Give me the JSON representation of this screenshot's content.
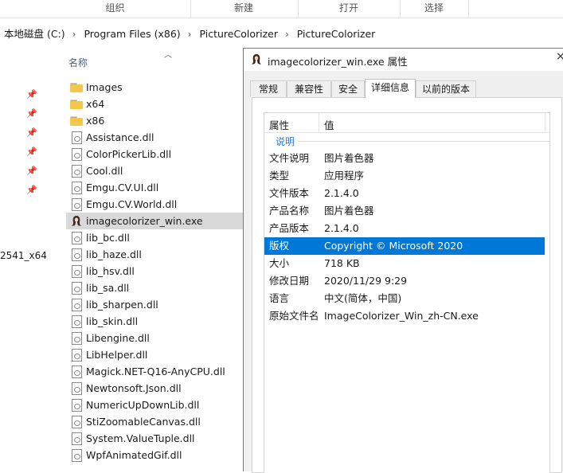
{
  "ribbon": {
    "groups": [
      "组织",
      "新建",
      "打开",
      "选择"
    ]
  },
  "address": {
    "crumbs": [
      "本地磁盘 (C:)",
      "Program Files (x86)",
      "PictureColorizer",
      "PictureColorizer"
    ]
  },
  "nav": {
    "fragment": "2541_x64"
  },
  "list": {
    "column": "名称",
    "items": [
      {
        "name": "Images",
        "type": "folder"
      },
      {
        "name": "x64",
        "type": "folder"
      },
      {
        "name": "x86",
        "type": "folder"
      },
      {
        "name": "Assistance.dll",
        "type": "dll"
      },
      {
        "name": "ColorPickerLib.dll",
        "type": "dll"
      },
      {
        "name": "Cool.dll",
        "type": "dll"
      },
      {
        "name": "Emgu.CV.UI.dll",
        "type": "dll"
      },
      {
        "name": "Emgu.CV.World.dll",
        "type": "dll"
      },
      {
        "name": "imagecolorizer_win.exe",
        "type": "exe",
        "selected": true
      },
      {
        "name": "lib_bc.dll",
        "type": "dll"
      },
      {
        "name": "lib_haze.dll",
        "type": "dll"
      },
      {
        "name": "lib_hsv.dll",
        "type": "dll"
      },
      {
        "name": "lib_sa.dll",
        "type": "dll"
      },
      {
        "name": "lib_sharpen.dll",
        "type": "dll"
      },
      {
        "name": "lib_skin.dll",
        "type": "dll"
      },
      {
        "name": "Libengine.dll",
        "type": "dll"
      },
      {
        "name": "LibHelper.dll",
        "type": "dll"
      },
      {
        "name": "Magick.NET-Q16-AnyCPU.dll",
        "type": "dll"
      },
      {
        "name": "Newtonsoft.Json.dll",
        "type": "dll"
      },
      {
        "name": "NumericUpDownLib.dll",
        "type": "dll"
      },
      {
        "name": "StiZoomableCanvas.dll",
        "type": "dll"
      },
      {
        "name": "System.ValueTuple.dll",
        "type": "dll"
      },
      {
        "name": "WpfAnimatedGif.dll",
        "type": "dll"
      }
    ]
  },
  "dialog": {
    "title": "imagecolorizer_win.exe 属性",
    "tabs": [
      {
        "label": "常规",
        "active": false
      },
      {
        "label": "兼容性",
        "active": false
      },
      {
        "label": "安全",
        "active": false
      },
      {
        "label": "详细信息",
        "active": true
      },
      {
        "label": "以前的版本",
        "active": false
      }
    ],
    "headers": {
      "property": "属性",
      "value": "值"
    },
    "section": "说明",
    "rows": [
      {
        "k": "文件说明",
        "v": "图片着色器"
      },
      {
        "k": "类型",
        "v": "应用程序"
      },
      {
        "k": "文件版本",
        "v": "2.1.4.0"
      },
      {
        "k": "产品名称",
        "v": "图片着色器"
      },
      {
        "k": "产品版本",
        "v": "2.1.4.0"
      },
      {
        "k": "版权",
        "v": "Copyright © Microsoft 2020",
        "selected": true
      },
      {
        "k": "大小",
        "v": "718 KB"
      },
      {
        "k": "修改日期",
        "v": "2020/11/29 9:29"
      },
      {
        "k": "语言",
        "v": "中文(简体，中国)"
      },
      {
        "k": "原始文件名",
        "v": "ImageColorizer_Win_zh-CN.exe"
      }
    ]
  },
  "colors": {
    "selection": "#0078d7",
    "row_highlight": "#d9d9d9",
    "folder": "#f3c74c",
    "section": "#3a77c4"
  }
}
